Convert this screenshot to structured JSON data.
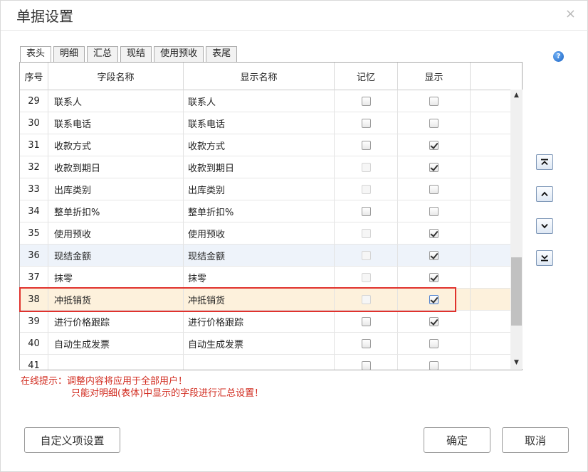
{
  "dialog": {
    "title": "单据设置",
    "close_label": "×"
  },
  "tabs": [
    {
      "label": "表头",
      "active": true
    },
    {
      "label": "明细",
      "active": false
    },
    {
      "label": "汇总",
      "active": false
    },
    {
      "label": "现结",
      "active": false
    },
    {
      "label": "使用预收",
      "active": false
    },
    {
      "label": "表尾",
      "active": false
    }
  ],
  "help_icon": {
    "glyph": "?",
    "icon": "help-icon"
  },
  "grid": {
    "columns": [
      "序号",
      "字段名称",
      "显示名称",
      "记忆",
      "显示",
      ""
    ],
    "rows": [
      {
        "no": "29",
        "field": "联系人",
        "display": "联系人",
        "memory": false,
        "memory_disabled": false,
        "show": false
      },
      {
        "no": "30",
        "field": "联系电话",
        "display": "联系电话",
        "memory": false,
        "memory_disabled": false,
        "show": false
      },
      {
        "no": "31",
        "field": "收款方式",
        "display": "收款方式",
        "memory": false,
        "memory_disabled": false,
        "show": true
      },
      {
        "no": "32",
        "field": "收款到期日",
        "display": "收款到期日",
        "memory": false,
        "memory_disabled": true,
        "show": true
      },
      {
        "no": "33",
        "field": "出库类别",
        "display": "出库类别",
        "memory": false,
        "memory_disabled": true,
        "show": false
      },
      {
        "no": "34",
        "field": "整单折扣%",
        "display": "整单折扣%",
        "memory": false,
        "memory_disabled": false,
        "show": false
      },
      {
        "no": "35",
        "field": "使用预收",
        "display": "使用预收",
        "memory": false,
        "memory_disabled": true,
        "show": true
      },
      {
        "no": "36",
        "field": "现结金额",
        "display": "现结金额",
        "memory": false,
        "memory_disabled": true,
        "show": true
      },
      {
        "no": "37",
        "field": "抹零",
        "display": "抹零",
        "memory": false,
        "memory_disabled": true,
        "show": true
      },
      {
        "no": "38",
        "field": "冲抵销货",
        "display": "冲抵销货",
        "memory": false,
        "memory_disabled": true,
        "show": true
      },
      {
        "no": "39",
        "field": "进行价格跟踪",
        "display": "进行价格跟踪",
        "memory": false,
        "memory_disabled": false,
        "show": true
      },
      {
        "no": "40",
        "field": "自动生成发票",
        "display": "自动生成发票",
        "memory": false,
        "memory_disabled": false,
        "show": false
      },
      {
        "no": "41",
        "field": "",
        "display": "",
        "memory": false,
        "memory_disabled": false,
        "show": false
      }
    ],
    "selected_row": "38",
    "alt_row": "36"
  },
  "side_buttons": [
    {
      "name": "move-top-button",
      "icon": "move-top-icon"
    },
    {
      "name": "move-up-button",
      "icon": "move-up-icon"
    },
    {
      "name": "move-down-button",
      "icon": "move-down-icon"
    },
    {
      "name": "move-bottom-button",
      "icon": "move-bottom-icon"
    }
  ],
  "hint": {
    "line1": "在线提示：调整内容将应用于全部用户！",
    "line2": "只能对明细(表体)中显示的字段进行汇总设置！"
  },
  "buttons": {
    "custom": "自定义项设置",
    "ok": "确定",
    "cancel": "取消"
  },
  "colors": {
    "highlight_border": "#e0322c",
    "hint_text": "#d12a1e",
    "selected_row_bg": "#fdf1dc",
    "alt_row_bg": "#eef3fa"
  }
}
